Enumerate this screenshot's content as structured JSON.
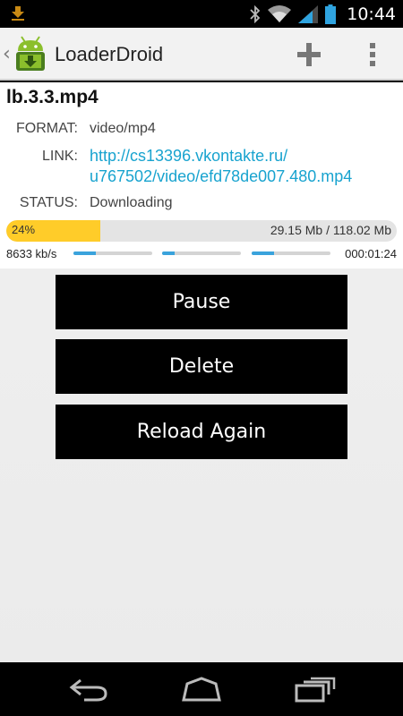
{
  "status_bar": {
    "time": "10:44"
  },
  "action_bar": {
    "title": "LoaderDroid"
  },
  "download": {
    "filename": "lb.3.3.mp4",
    "format_label": "FORMAT:",
    "format_value": "video/mp4",
    "link_label": "LINK:",
    "link_line1": "http://cs13396.vkontakte.ru/",
    "link_line2": "u767502/video/efd78de007.480.mp4",
    "status_label": "STATUS:",
    "status_value": "Downloading",
    "progress_text": "24%",
    "progress_fraction": 0.24,
    "size_text": "29.15 Mb / 118.02 Mb",
    "speed": "8633 kb/s",
    "eta": "000:01:24",
    "segments": [
      0.28,
      0.16,
      0.28
    ]
  },
  "buttons": {
    "pause": "Pause",
    "delete": "Delete",
    "reload": "Reload Again"
  },
  "colors": {
    "accent_link": "#18a3cf",
    "progress_fill": "#ffcc29",
    "segment_fill": "#3aa3dc"
  }
}
